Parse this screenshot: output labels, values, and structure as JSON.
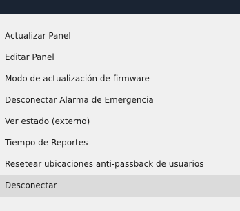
{
  "menu": {
    "items": [
      {
        "label": "Actualizar Panel"
      },
      {
        "label": "Editar Panel"
      },
      {
        "label": "Modo de actualización de firmware"
      },
      {
        "label": "Desconectar Alarma de Emergencia"
      },
      {
        "label": "Ver estado (externo)"
      },
      {
        "label": "Tiempo de Reportes"
      },
      {
        "label": "Resetear ubicaciones anti-passback de usuarios"
      },
      {
        "label": "Desconectar",
        "highlighted": true
      }
    ]
  },
  "colors": {
    "top_bar": "#1a2433",
    "menu_background": "#f0f0f0",
    "highlight": "#dbdbdb",
    "text": "#1b1b1b"
  }
}
